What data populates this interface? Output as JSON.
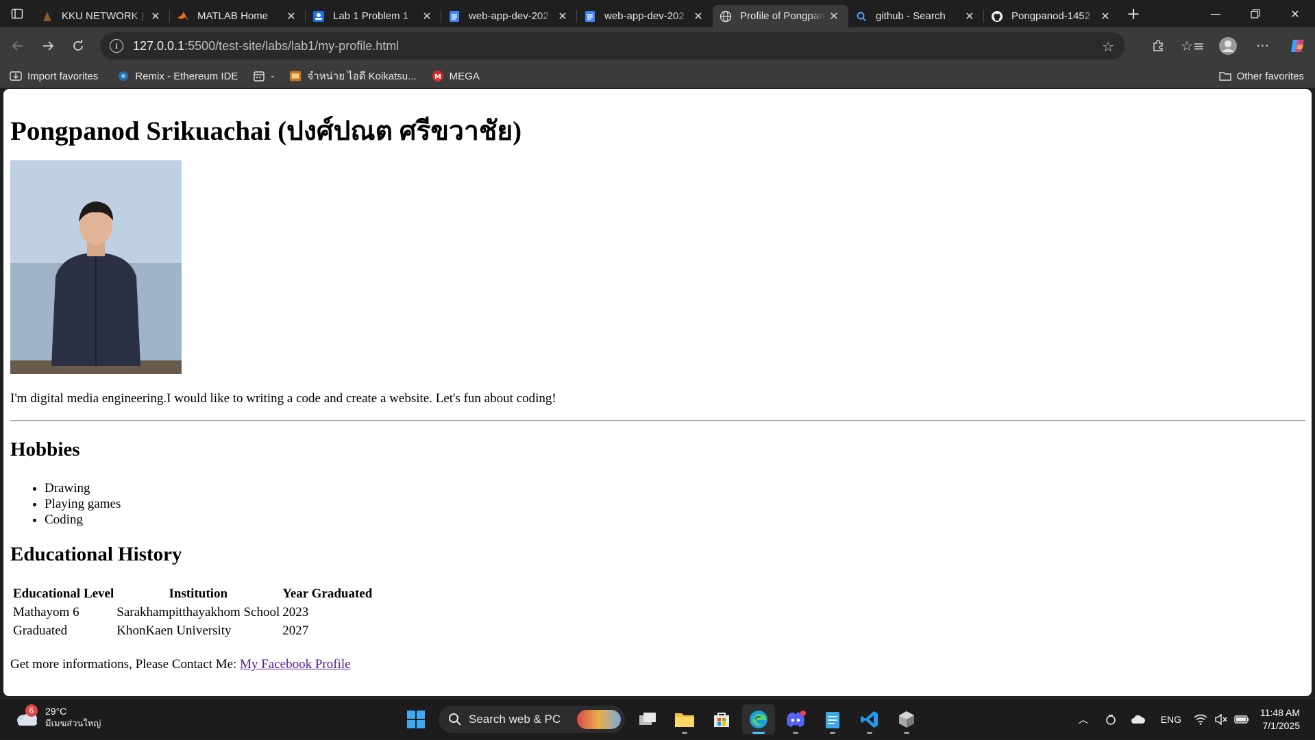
{
  "browser": {
    "tabs": [
      {
        "title": "KKU NETWORK | S",
        "icon": "kku-icon",
        "active": false
      },
      {
        "title": "MATLAB Home",
        "icon": "matlab-icon",
        "active": false
      },
      {
        "title": "Lab 1 Problem 1",
        "icon": "classroom-icon",
        "active": false
      },
      {
        "title": "web-app-dev-202",
        "icon": "docs-icon",
        "active": false
      },
      {
        "title": "web-app-dev-202",
        "icon": "docs-icon",
        "active": false
      },
      {
        "title": "Profile of Pongpan",
        "icon": "globe-icon",
        "active": true
      },
      {
        "title": "github - Search",
        "icon": "bing-search-icon",
        "active": false
      },
      {
        "title": "Pongpanod-1452",
        "icon": "github-icon",
        "active": false
      }
    ],
    "url_host": "127.0.0.1",
    "url_path": ":5500/test-site/labs/lab1/my-profile.html",
    "favorites": [
      {
        "label": "Import favorites",
        "icon": "import-icon"
      },
      {
        "label": "Remix - Ethereum IDE",
        "icon": "remix-icon"
      },
      {
        "label": "-",
        "icon": "calendar-icon"
      },
      {
        "label": "จำหน่าย ไอดี Koikatsu...",
        "icon": "shop-icon"
      },
      {
        "label": "MEGA",
        "icon": "mega-icon"
      }
    ],
    "other_favorites": "Other favorites"
  },
  "page": {
    "heading": "Pongpanod Srikuachai (ปงศ์ปณต ศรีขวาชัย)",
    "intro": "I'm digital media engineering.I would like to writing a code and create a website. Let's fun about coding!",
    "hobbies_heading": "Hobbies",
    "hobbies": [
      "Drawing",
      "Playing games",
      "Coding"
    ],
    "education_heading": "Educational History",
    "table_headers": [
      "Educational Level",
      "Institution",
      "Year Graduated"
    ],
    "table_rows": [
      [
        "Mathayom 6",
        "Sarakhampitthayakhom School",
        "2023"
      ],
      [
        "Graduated",
        "KhonKaen University",
        "2027"
      ]
    ],
    "contact_text": "Get more informations, Please Contact Me: ",
    "contact_link": "My Facebook Profile"
  },
  "taskbar": {
    "weather_badge": "6",
    "weather_temp": "29°C",
    "weather_location": "มีเมฆส่วนใหญ่",
    "search_placeholder": "Search web & PC",
    "language": "ENG",
    "time": "11:48 AM",
    "date": "7/1/2025"
  },
  "colors": {
    "accent": "#4cc2ff",
    "link_visited": "#551a8b"
  }
}
